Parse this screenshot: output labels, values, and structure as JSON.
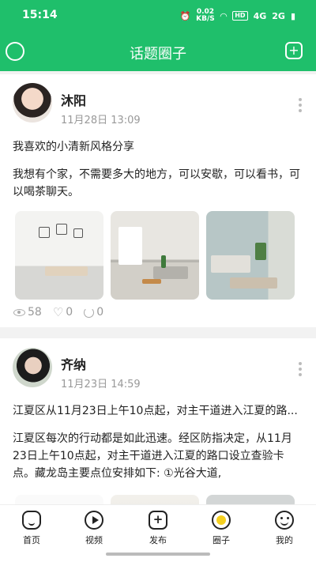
{
  "status_bar": {
    "time": "15:14",
    "net_speed_value": "0.02",
    "net_speed_unit": "KB/S",
    "hd": "HD",
    "signal_1": "4G",
    "signal_2": "2G"
  },
  "header": {
    "title": "话题圈子"
  },
  "posts": [
    {
      "author": "沐阳",
      "date": "11月28日 13:09",
      "title": "我喜欢的小清新风格分享",
      "body": "我想有个家，不需要多大的地方，可以安歇，可以看书，可以喝茶聊天。",
      "views": "58",
      "likes": "0",
      "shares": "0"
    },
    {
      "author": "齐纳",
      "date": "11月23日 14:59",
      "title": "江夏区从11月23日上午10点起，对主干道进入江夏的路...",
      "body": "江夏区每次的行动都是如此迅速。经区防指决定，从11月23日上午10点起，对主干道进入江夏的路口设立查验卡点。藏龙岛主要点位安排如下: ①光谷大道,"
    }
  ],
  "tabs": [
    {
      "label": "首页",
      "icon": "home-icon"
    },
    {
      "label": "视频",
      "icon": "video-icon"
    },
    {
      "label": "发布",
      "icon": "publish-icon"
    },
    {
      "label": "圈子",
      "icon": "circle-icon"
    },
    {
      "label": "我的",
      "icon": "profile-icon"
    }
  ],
  "colors": {
    "brand": "#1fbf6b",
    "active_circle": "#f5d020"
  }
}
